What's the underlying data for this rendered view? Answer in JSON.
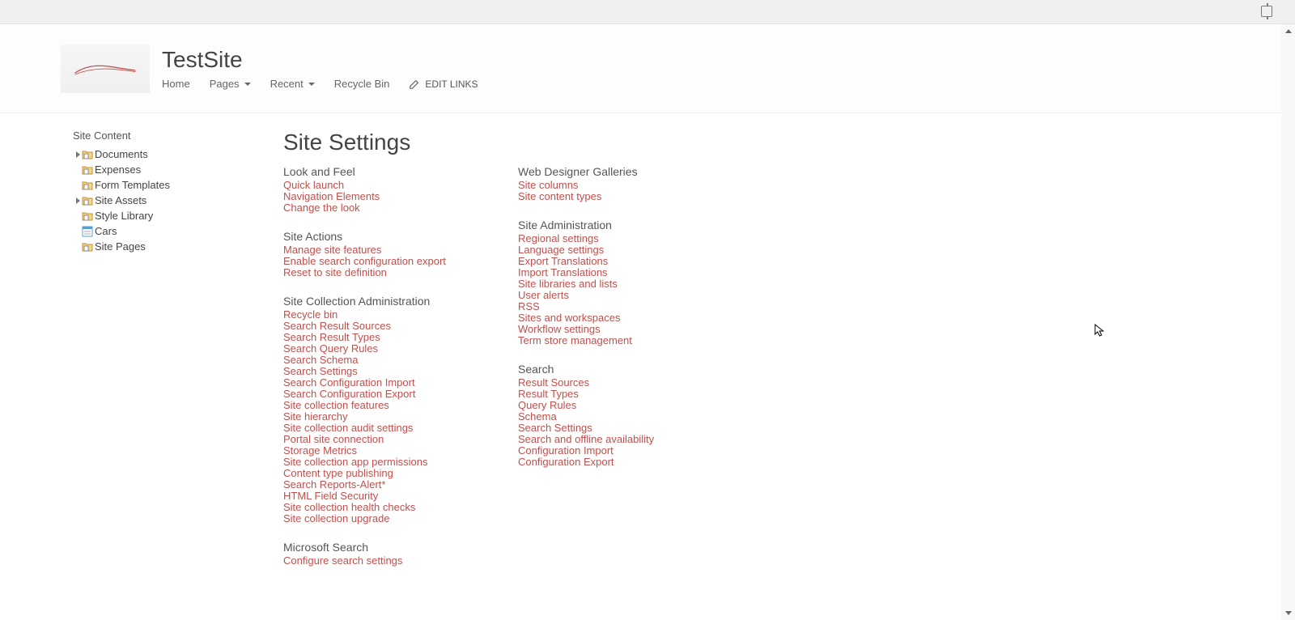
{
  "site": {
    "title": "TestSite"
  },
  "topNav": {
    "items": [
      {
        "label": "Home",
        "hasDropdown": false
      },
      {
        "label": "Pages",
        "hasDropdown": true
      },
      {
        "label": "Recent",
        "hasDropdown": true
      },
      {
        "label": "Recycle Bin",
        "hasDropdown": false
      }
    ],
    "editLinks": "EDIT LINKS"
  },
  "leftNav": {
    "header": "Site Content",
    "items": [
      {
        "label": "Documents",
        "expandable": true,
        "iconType": "doclib"
      },
      {
        "label": "Expenses",
        "expandable": false,
        "iconType": "doclib"
      },
      {
        "label": "Form Templates",
        "expandable": false,
        "iconType": "doclib"
      },
      {
        "label": "Site Assets",
        "expandable": true,
        "iconType": "doclib"
      },
      {
        "label": "Style Library",
        "expandable": false,
        "iconType": "doclib"
      },
      {
        "label": "Cars",
        "expandable": false,
        "iconType": "list"
      },
      {
        "label": "Site Pages",
        "expandable": false,
        "iconType": "doclib"
      }
    ]
  },
  "settings": {
    "pageTitle": "Site Settings",
    "colA": [
      {
        "header": "Look and Feel",
        "links": [
          "Quick launch",
          "Navigation Elements",
          "Change the look"
        ]
      },
      {
        "header": "Site Actions",
        "links": [
          "Manage site features",
          "Enable search configuration export",
          "Reset to site definition"
        ]
      },
      {
        "header": "Site Collection Administration",
        "links": [
          "Recycle bin",
          "Search Result Sources",
          "Search Result Types",
          "Search Query Rules",
          "Search Schema",
          "Search Settings",
          "Search Configuration Import",
          "Search Configuration Export",
          "Site collection features",
          "Site hierarchy",
          "Site collection audit settings",
          "Portal site connection",
          "Storage Metrics",
          "Site collection app permissions",
          "Content type publishing",
          "Search Reports-Alert*",
          "HTML Field Security",
          "Site collection health checks",
          "Site collection upgrade"
        ]
      },
      {
        "header": "Microsoft Search",
        "links": [
          "Configure search settings"
        ]
      }
    ],
    "colB": [
      {
        "header": "Web Designer Galleries",
        "links": [
          "Site columns",
          "Site content types"
        ]
      },
      {
        "header": "Site Administration",
        "links": [
          "Regional settings",
          "Language settings",
          "Export Translations",
          "Import Translations",
          "Site libraries and lists",
          "User alerts",
          "RSS",
          "Sites and workspaces",
          "Workflow settings",
          "Term store management"
        ]
      },
      {
        "header": "Search",
        "links": [
          "Result Sources",
          "Result Types",
          "Query Rules",
          "Schema",
          "Search Settings",
          "Search and offline availability",
          "Configuration Import",
          "Configuration Export"
        ]
      }
    ]
  }
}
